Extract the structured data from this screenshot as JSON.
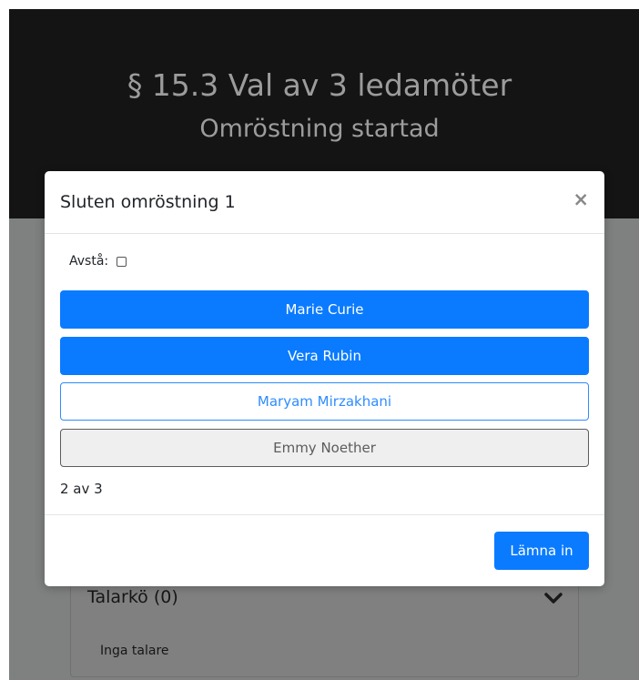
{
  "header": {
    "title": "§ 15.3 Val av 3 ledamöter",
    "subtitle": "Omröstning startad"
  },
  "background_card": {
    "title": "Talarkö (0)",
    "empty_text": "Inga talare",
    "chevron_icon": "chevron-down-icon"
  },
  "modal": {
    "title": "Sluten omröstning 1",
    "close_label": "×",
    "abstain_label": "Avstå:",
    "abstain_checked": false,
    "candidates": [
      {
        "name": "Marie Curie",
        "state": "selected"
      },
      {
        "name": "Vera Rubin",
        "state": "selected"
      },
      {
        "name": "Maryam Mirzakhani",
        "state": "unselected"
      },
      {
        "name": "Emmy Noether",
        "state": "disabled"
      }
    ],
    "count_text": "2 av 3",
    "submit_label": "Lämna in"
  },
  "colors": {
    "primary": "#0a7bff",
    "header_bg": "#141414",
    "overlay_bg": "#7e8180"
  }
}
